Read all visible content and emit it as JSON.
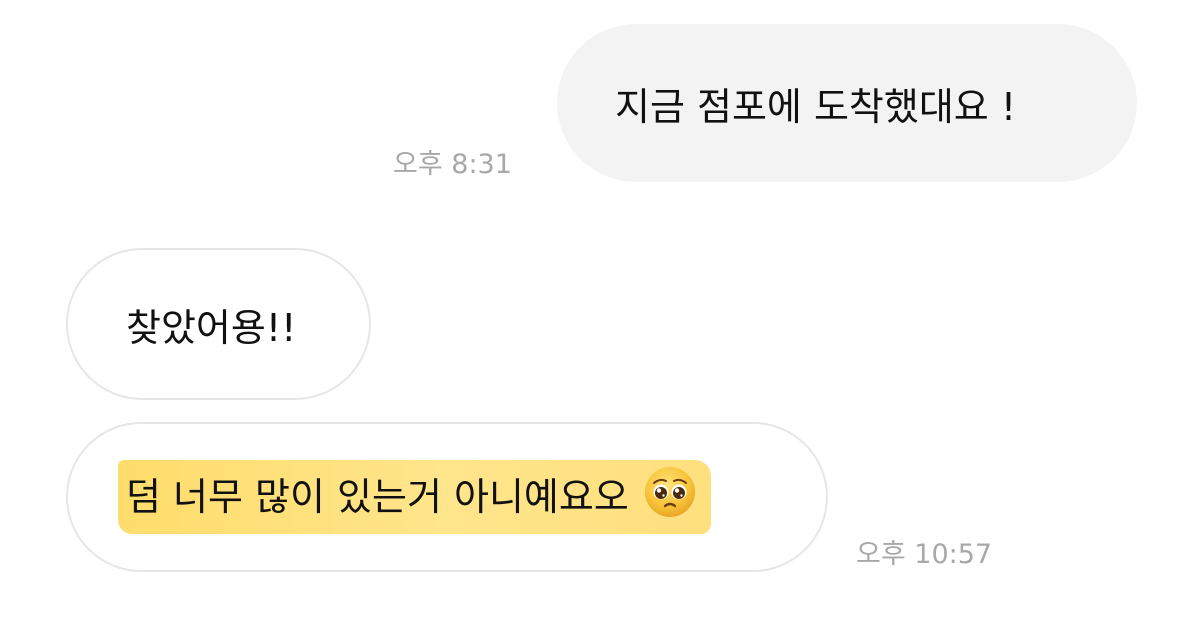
{
  "messages": [
    {
      "direction": "sent",
      "text": "지금 점포에 도착했대요 !",
      "time": "오후 8:31"
    },
    {
      "direction": "received",
      "text": "찾았어용!!"
    },
    {
      "direction": "received",
      "text": "덤 너무 많이 있는거 아니예요오",
      "emoji": "pleading-face-icon",
      "highlighted": true,
      "time": "오후 10:57"
    }
  ],
  "colors": {
    "sent_bubble": "#f3f3f3",
    "received_border": "#e6e6e6",
    "highlight": "#ffd13a",
    "timestamp": "#a8a8a8"
  }
}
